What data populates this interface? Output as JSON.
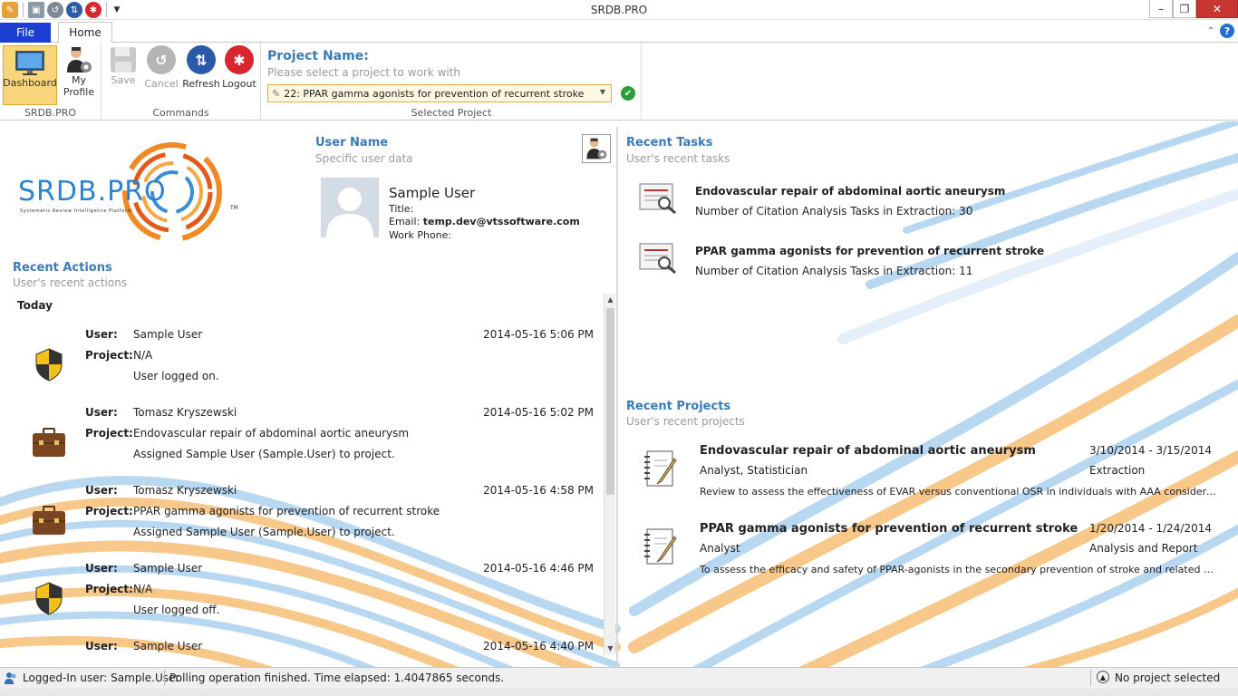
{
  "window": {
    "title": "SRDB.PRO"
  },
  "tabs": {
    "file": "File",
    "home": "Home"
  },
  "ribbon": {
    "groups": {
      "srdb": "SRDB.PRO",
      "commands": "Commands",
      "selected_project": "Selected Project"
    },
    "buttons": {
      "dashboard": "Dashboard",
      "my_profile_1": "My",
      "my_profile_2": "Profile",
      "save": "Save",
      "cancel": "Cancel",
      "refresh": "Refresh",
      "logout": "Logout"
    },
    "project": {
      "label": "Project Name:",
      "hint": "Please select a project to work with",
      "selected": "22: PPAR gamma agonists for prevention of recurrent stroke"
    }
  },
  "logo": {
    "text": "SRDB.PRO",
    "tagline": "Systematic Review Intelligence Platform",
    "tm": "TM"
  },
  "user": {
    "section_title": "User Name",
    "section_sub": "Specific user data",
    "name": "Sample User",
    "title_label": "Title:",
    "email_label": "Email:",
    "email": "temp.dev@vtssoftware.com",
    "phone_label": "Work Phone:"
  },
  "recent_actions": {
    "title": "Recent Actions",
    "sub": "User's recent actions",
    "group": "Today",
    "labels": {
      "user": "User:",
      "project": "Project:"
    },
    "items": [
      {
        "icon": "shield-icon",
        "user": "Sample User",
        "project": "N/A",
        "time": "2014-05-16 5:06 PM",
        "message": "User logged on."
      },
      {
        "icon": "briefcase-icon",
        "user": "Tomasz Kryszewski",
        "project": "Endovascular repair of abdominal aortic aneurysm",
        "time": "2014-05-16 5:02 PM",
        "message": "Assigned Sample User (Sample.User) to project."
      },
      {
        "icon": "briefcase-icon",
        "user": "Tomasz Kryszewski",
        "project": "PPAR gamma agonists for prevention of recurrent stroke",
        "time": "2014-05-16 4:58 PM",
        "message": "Assigned Sample User (Sample.User) to project."
      },
      {
        "icon": "shield-icon",
        "user": "Sample User",
        "project": "N/A",
        "time": "2014-05-16 4:46 PM",
        "message": "User logged off."
      },
      {
        "icon": "shield-icon",
        "user": "Sample User",
        "project": "",
        "time": "2014-05-16 4:40 PM",
        "message": ""
      }
    ]
  },
  "recent_tasks": {
    "title": "Recent Tasks",
    "sub": "User's recent tasks",
    "items": [
      {
        "title": "Endovascular repair of abdominal aortic aneurysm",
        "detail": "Number of Citation Analysis Tasks in Extraction: 30"
      },
      {
        "title": "PPAR gamma agonists for prevention of recurrent stroke",
        "detail": "Number of Citation Analysis Tasks in Extraction: 11"
      }
    ]
  },
  "recent_projects": {
    "title": "Recent Projects",
    "sub": "User's recent projects",
    "items": [
      {
        "title": "Endovascular repair of abdominal aortic aneurysm",
        "roles": "Analyst, Statistician",
        "dates": "3/10/2014 - 3/15/2014",
        "phase": "Extraction",
        "description": "Review to assess the effectiveness of EVAR versus conventional OSR in individuals with AAA considered fit..."
      },
      {
        "title": "PPAR gamma agonists for prevention of recurrent stroke",
        "roles": "Analyst",
        "dates": "1/20/2014 - 1/24/2014",
        "phase": "Analysis and Report",
        "description": "To assess the efficacy and safety of PPAR-agonists in the secondary prevention of stroke and related vasc..."
      }
    ]
  },
  "status": {
    "logged_in": "Logged-In user: Sample.User",
    "polling": "Polling operation finished. Time elapsed: 1.4047865 seconds.",
    "project": "No project selected"
  },
  "colors": {
    "accent": "#3d7ab8",
    "file_tab": "#1b3fd1",
    "active_button": "#f7d57b",
    "close": "#c7372f",
    "wave_orange": "#f39a2b",
    "wave_blue": "#7fb8e6"
  }
}
